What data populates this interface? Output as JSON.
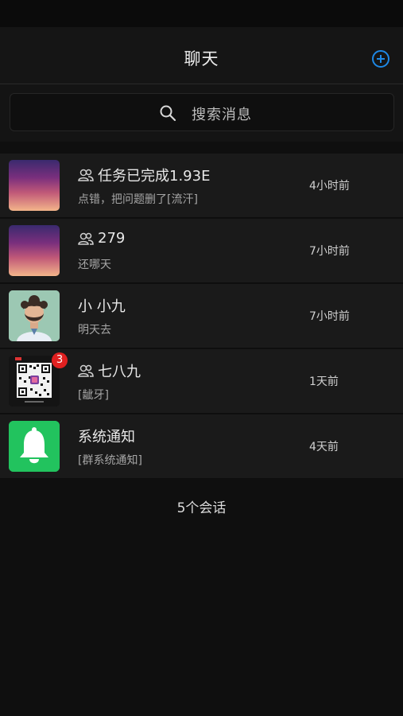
{
  "header": {
    "title": "聊天"
  },
  "search": {
    "placeholder": "搜索消息"
  },
  "chats": [
    {
      "name": "任务已完成1.93E",
      "is_group": true,
      "preview": "点错，把问题删了[流汗]",
      "time": "4小时前",
      "avatar": "gradient-image"
    },
    {
      "name": "279",
      "is_group": true,
      "preview": "还哪天",
      "time": "7小时前",
      "avatar": "gradient-image"
    },
    {
      "name": "小 小九",
      "is_group": false,
      "preview": "明天去",
      "time": "7小时前",
      "avatar": "person-avatar"
    },
    {
      "name": "七八九",
      "is_group": true,
      "preview": "[龇牙]",
      "time": "1天前",
      "avatar": "qr-code-image",
      "unread": "3"
    },
    {
      "name": "系统通知",
      "is_group": false,
      "preview": "[群系统通知]",
      "time": "4天前",
      "avatar": "bell-icon"
    }
  ],
  "footer": {
    "count_text": "5个会话"
  },
  "colors": {
    "accent": "#1e88e5",
    "badge": "#e02020",
    "bell_bg": "#22c35e"
  }
}
